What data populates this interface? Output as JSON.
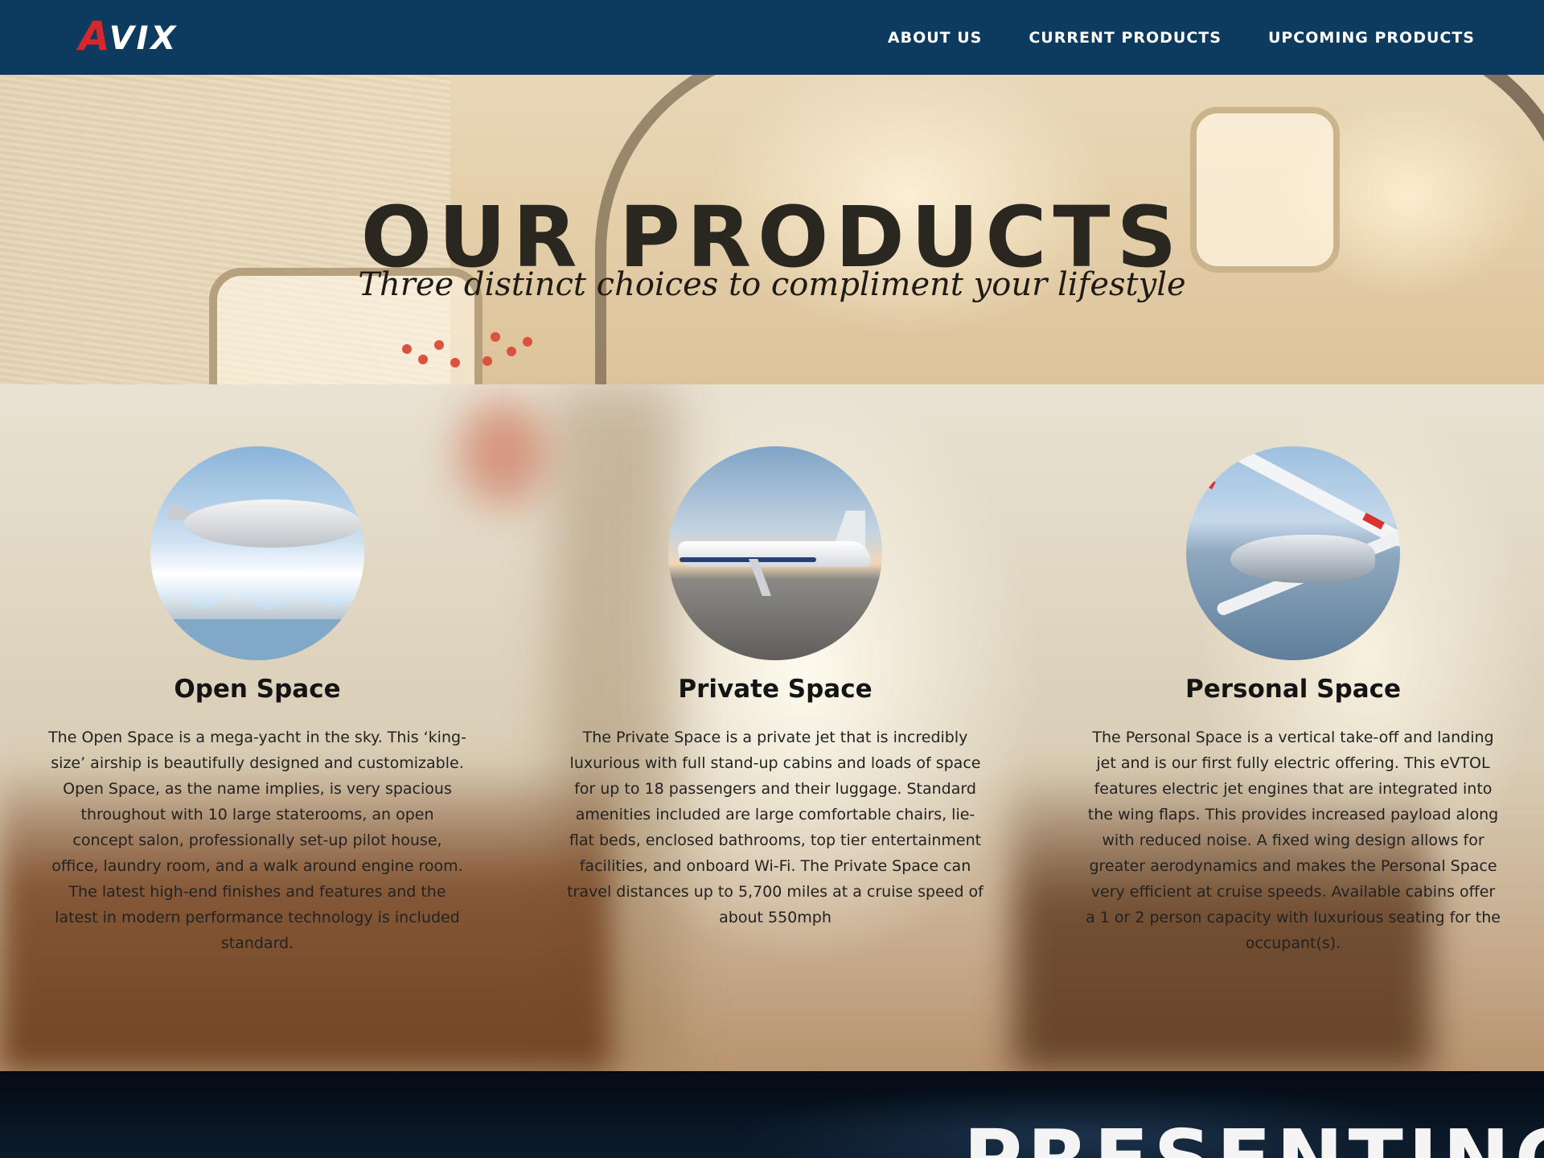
{
  "nav": {
    "logo_first": "A",
    "logo_rest": "VIX",
    "links": [
      "ABOUT US",
      "CURRENT PRODUCTS",
      "UPCOMING PRODUCTS"
    ]
  },
  "hero": {
    "title": "OUR PRODUCTS",
    "subtitle": "Three distinct choices to compliment your lifestyle"
  },
  "products": [
    {
      "title": "Open Space",
      "description": "The Open Space is a mega-yacht in the sky. This ‘king-size’ airship is beautifully designed and customizable. Open Space, as the name implies, is very spacious throughout with 10 large staterooms, an open concept salon, professionally set-up pilot house, office, laundry room, and a walk around engine room. The latest high-end finishes and features and the latest in modern performance technology is included standard.",
      "image": "airship"
    },
    {
      "title": "Private Space",
      "description": "The Private Space is a private jet that is incredibly luxurious with full stand-up cabins and loads of space for up to 18 passengers and their luggage. Standard amenities included are large comfortable chairs, lie-flat beds, enclosed bathrooms, top tier entertainment facilities, and onboard Wi-Fi. The Private Space can travel distances up to 5,700 miles at a cruise speed of about 550mph",
      "image": "private-jet"
    },
    {
      "title": "Personal Space",
      "description": "The Personal Space is a vertical take-off and landing jet and is our first fully electric offering. This eVTOL features electric jet engines that are integrated into the wing flaps. This provides increased payload along with reduced noise. A fixed wing design allows for greater aerodynamics and makes the Personal Space very efficient at cruise speeds. Available cabins offer a 1 or 2 person capacity with luxurious seating for the occupant(s).",
      "image": "evtol"
    }
  ],
  "banner": {
    "text": "PRESENTING:"
  },
  "colors": {
    "nav_bg": "#0d3a5f",
    "logo_accent": "#d7262e",
    "hero_title": "#2a2620"
  }
}
